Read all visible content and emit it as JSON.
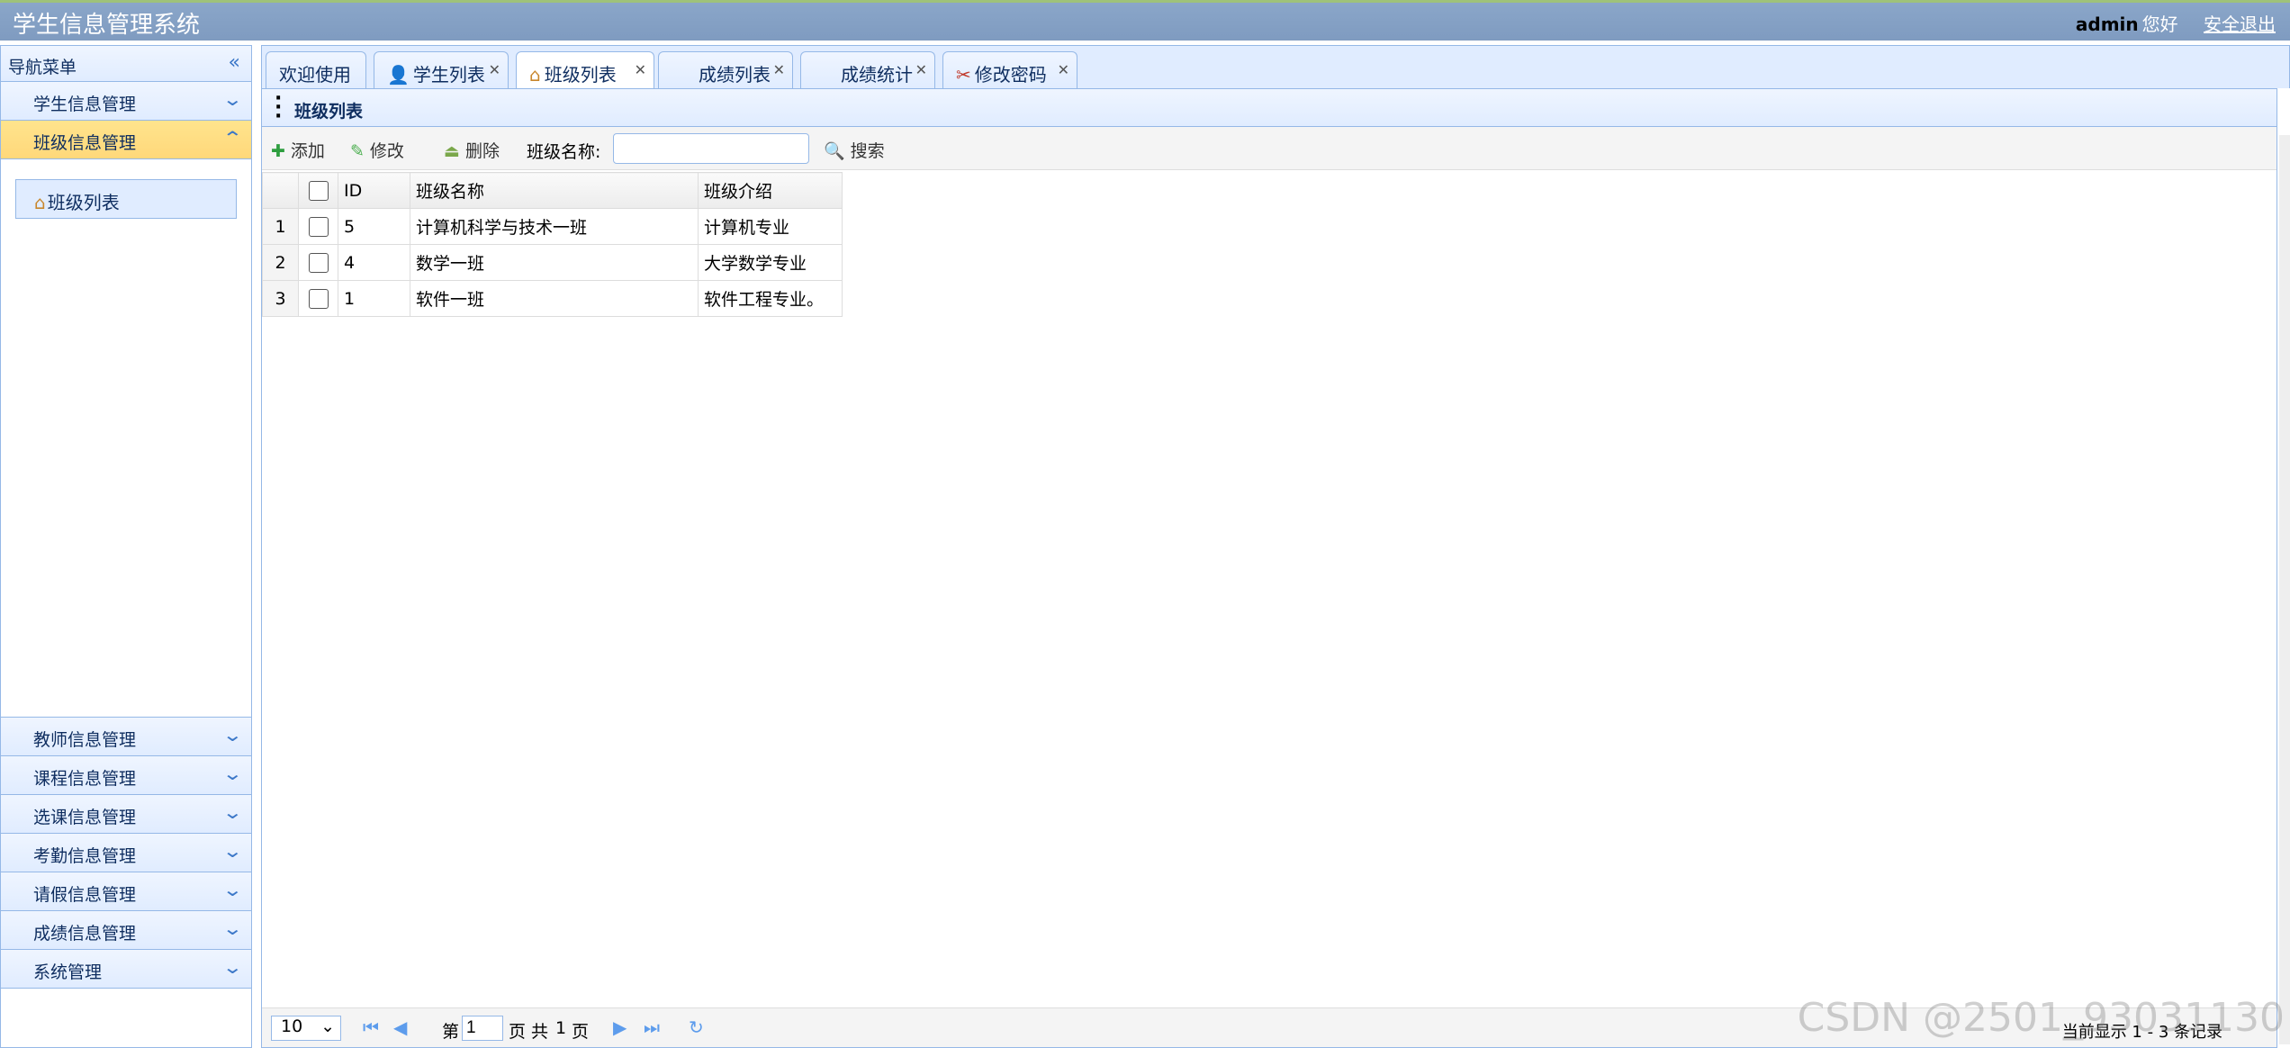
{
  "header": {
    "title": "学生信息管理系统",
    "user": "admin",
    "greeting": "您好",
    "logout": "安全退出"
  },
  "sidebar": {
    "title": "导航菜单",
    "top_items": [
      {
        "label": "学生信息管理",
        "expanded": false
      },
      {
        "label": "班级信息管理",
        "expanded": true
      }
    ],
    "sub_items": [
      {
        "label": "班级列表"
      }
    ],
    "bottom_items": [
      {
        "label": "教师信息管理"
      },
      {
        "label": "课程信息管理"
      },
      {
        "label": "选课信息管理"
      },
      {
        "label": "考勤信息管理"
      },
      {
        "label": "请假信息管理"
      },
      {
        "label": "成绩信息管理"
      },
      {
        "label": "系统管理"
      }
    ]
  },
  "tabs": [
    {
      "label": "欢迎使用",
      "icon": "none",
      "closable": false
    },
    {
      "label": "学生列表",
      "icon": "user-icon",
      "closable": true
    },
    {
      "label": "班级列表",
      "icon": "house-icon",
      "closable": true,
      "selected": true
    },
    {
      "label": "成绩列表",
      "icon": "none",
      "closable": true
    },
    {
      "label": "成绩统计",
      "icon": "none",
      "closable": true
    },
    {
      "label": "修改密码",
      "icon": "tools-icon",
      "closable": true
    }
  ],
  "panel": {
    "title": "班级列表"
  },
  "toolbar": {
    "add": "添加",
    "edit": "修改",
    "delete": "删除",
    "search_label": "班级名称:",
    "search_value": "",
    "search": "搜索"
  },
  "table": {
    "columns": [
      "ID",
      "班级名称",
      "班级介绍"
    ],
    "rows": [
      {
        "rn": "1",
        "id": "5",
        "name": "计算机科学与技术一班",
        "intro": "计算机专业"
      },
      {
        "rn": "2",
        "id": "4",
        "name": "数学一班",
        "intro": "大学数学专业"
      },
      {
        "rn": "3",
        "id": "1",
        "name": "软件一班",
        "intro": "软件工程专业。"
      }
    ]
  },
  "pager": {
    "page_size": "10",
    "page_prefix": "第",
    "page": "1",
    "page_mid": "页 共",
    "total_pages": "1",
    "page_suffix": "页",
    "info": "当前显示 1 - 3 条记录"
  },
  "watermark": "CSDN @2501_93031130",
  "colors": {
    "header": "#8aa6c9",
    "border": "#95b8e7",
    "selected": "#ffe48d",
    "accent": "#3b77c8"
  }
}
